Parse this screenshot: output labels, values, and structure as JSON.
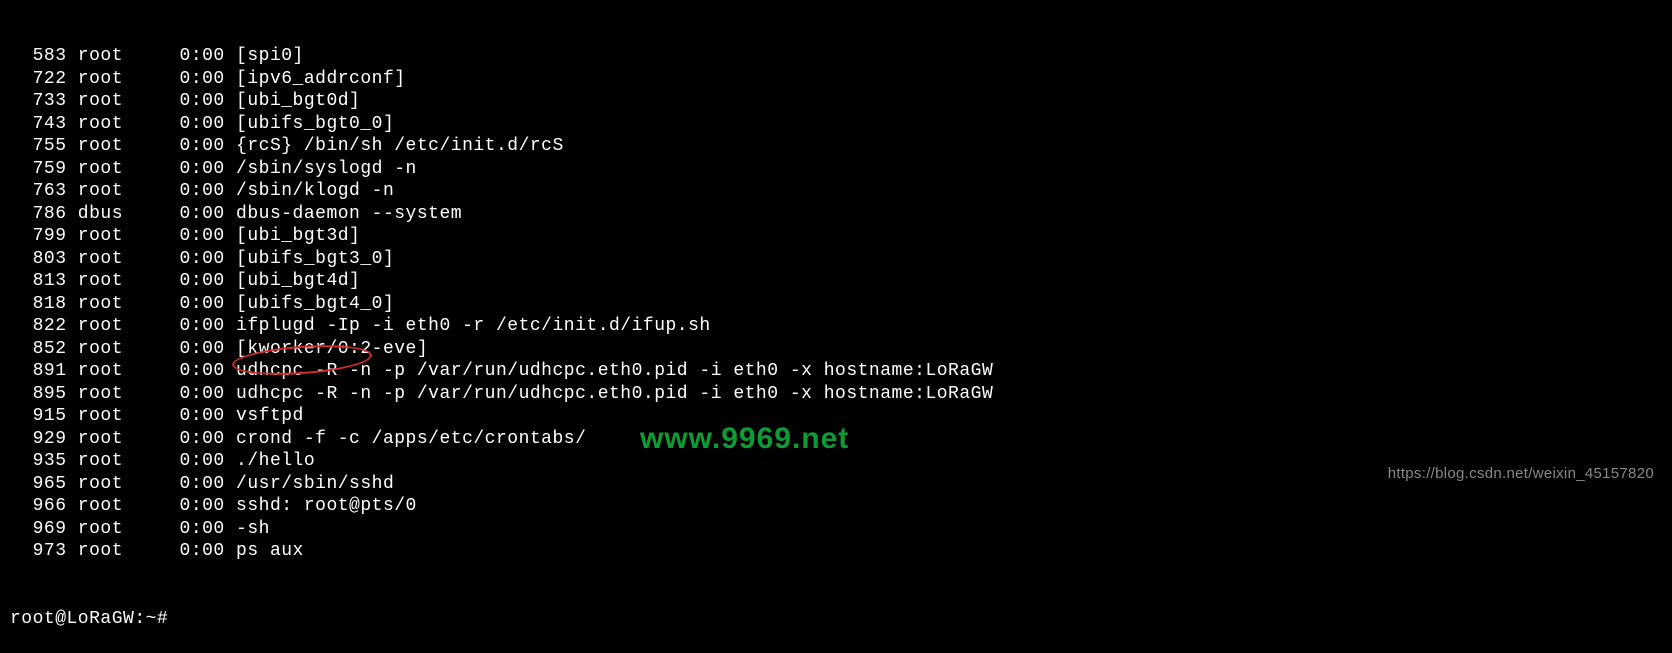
{
  "processes": [
    {
      "pid": "583",
      "user": "root",
      "time": "0:00",
      "cmd": "[spi0]"
    },
    {
      "pid": "722",
      "user": "root",
      "time": "0:00",
      "cmd": "[ipv6_addrconf]"
    },
    {
      "pid": "733",
      "user": "root",
      "time": "0:00",
      "cmd": "[ubi_bgt0d]"
    },
    {
      "pid": "743",
      "user": "root",
      "time": "0:00",
      "cmd": "[ubifs_bgt0_0]"
    },
    {
      "pid": "755",
      "user": "root",
      "time": "0:00",
      "cmd": "{rcS} /bin/sh /etc/init.d/rcS"
    },
    {
      "pid": "759",
      "user": "root",
      "time": "0:00",
      "cmd": "/sbin/syslogd -n"
    },
    {
      "pid": "763",
      "user": "root",
      "time": "0:00",
      "cmd": "/sbin/klogd -n"
    },
    {
      "pid": "786",
      "user": "dbus",
      "time": "0:00",
      "cmd": "dbus-daemon --system"
    },
    {
      "pid": "799",
      "user": "root",
      "time": "0:00",
      "cmd": "[ubi_bgt3d]"
    },
    {
      "pid": "803",
      "user": "root",
      "time": "0:00",
      "cmd": "[ubifs_bgt3_0]"
    },
    {
      "pid": "813",
      "user": "root",
      "time": "0:00",
      "cmd": "[ubi_bgt4d]"
    },
    {
      "pid": "818",
      "user": "root",
      "time": "0:00",
      "cmd": "[ubifs_bgt4_0]"
    },
    {
      "pid": "822",
      "user": "root",
      "time": "0:00",
      "cmd": "ifplugd -Ip -i eth0 -r /etc/init.d/ifup.sh"
    },
    {
      "pid": "852",
      "user": "root",
      "time": "0:00",
      "cmd": "[kworker/0:2-eve]"
    },
    {
      "pid": "891",
      "user": "root",
      "time": "0:00",
      "cmd": "udhcpc -R -n -p /var/run/udhcpc.eth0.pid -i eth0 -x hostname:LoRaGW"
    },
    {
      "pid": "895",
      "user": "root",
      "time": "0:00",
      "cmd": "udhcpc -R -n -p /var/run/udhcpc.eth0.pid -i eth0 -x hostname:LoRaGW"
    },
    {
      "pid": "915",
      "user": "root",
      "time": "0:00",
      "cmd": "vsftpd"
    },
    {
      "pid": "929",
      "user": "root",
      "time": "0:00",
      "cmd": "crond -f -c /apps/etc/crontabs/"
    },
    {
      "pid": "935",
      "user": "root",
      "time": "0:00",
      "cmd": "./hello"
    },
    {
      "pid": "965",
      "user": "root",
      "time": "0:00",
      "cmd": "/usr/sbin/sshd"
    },
    {
      "pid": "966",
      "user": "root",
      "time": "0:00",
      "cmd": "sshd: root@pts/0"
    },
    {
      "pid": "969",
      "user": "root",
      "time": "0:00",
      "cmd": "-sh"
    },
    {
      "pid": "973",
      "user": "root",
      "time": "0:00",
      "cmd": "ps aux"
    }
  ],
  "prompt": "root@LoRaGW:~#",
  "watermark_center": "www.9969.net",
  "watermark_right": "https://blog.csdn.net/weixin_45157820"
}
